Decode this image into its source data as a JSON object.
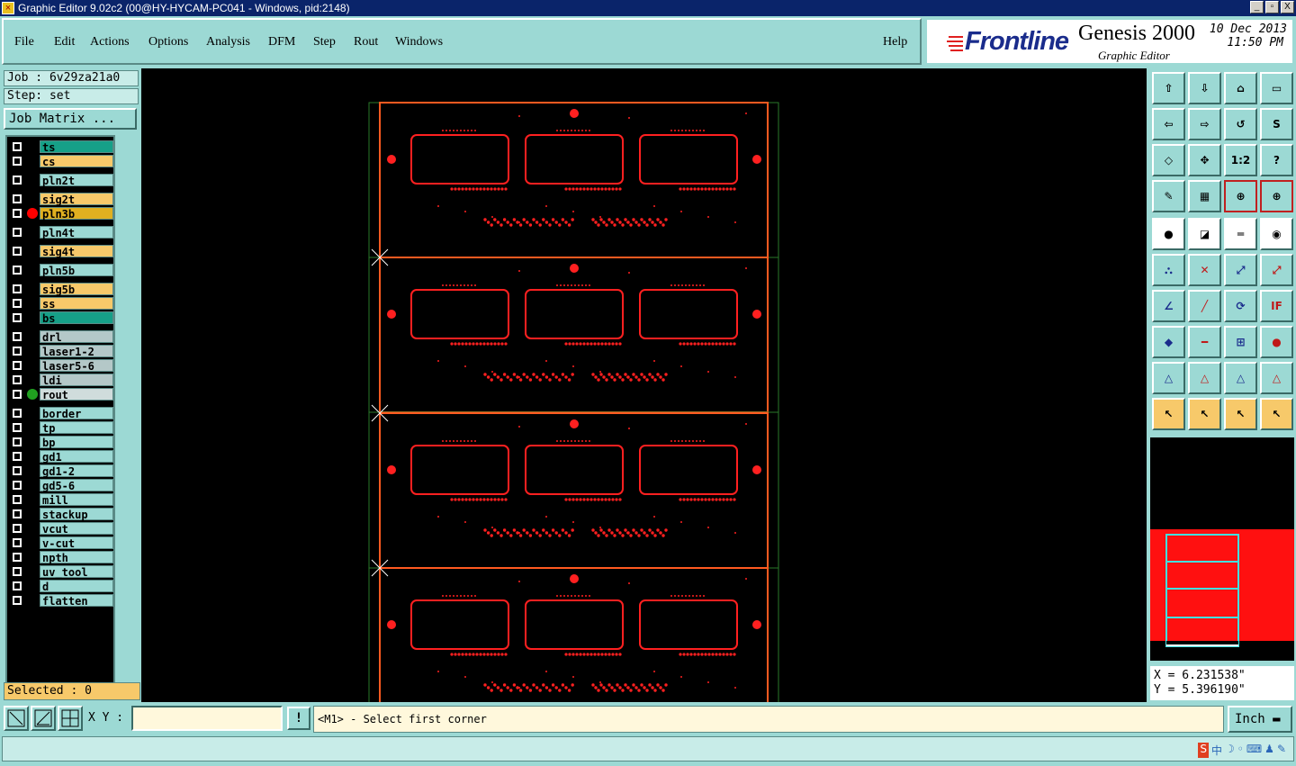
{
  "window": {
    "title": "Graphic Editor 9.02c2 (00@HY-HYCAM-PC041 - Windows, pid:2148)",
    "minimize": "_",
    "maximize": "▫",
    "close": "X"
  },
  "menu": {
    "file": "File",
    "edit": "Edit",
    "actions": "Actions",
    "options": "Options",
    "analysis": "Analysis",
    "dfm": "DFM",
    "step": "Step",
    "rout": "Rout",
    "windows": "Windows",
    "help": "Help"
  },
  "brand": {
    "logo": "Frontline",
    "product": "Genesis 2000",
    "subtitle": "Graphic Editor",
    "date": "10 Dec 2013",
    "time": "11:50 PM"
  },
  "left": {
    "job": "Job : 6v29za21a0",
    "step": "Step: set",
    "job_matrix": "Job Matrix ...",
    "selected": "Selected : 0"
  },
  "layers": [
    {
      "name": "ts",
      "color": "#16a088",
      "dot": ""
    },
    {
      "name": "cs",
      "color": "#f7c96a",
      "dot": ""
    },
    {
      "name": "pln2t",
      "color": "#9cd9d4",
      "dot": ""
    },
    {
      "name": "sig2t",
      "color": "#f7c96a",
      "dot": ""
    },
    {
      "name": "pln3b",
      "color": "#e0b020",
      "dot": "#ff0000"
    },
    {
      "name": "pln4t",
      "color": "#9cd9d4",
      "dot": ""
    },
    {
      "name": "sig4t",
      "color": "#f7c96a",
      "dot": ""
    },
    {
      "name": "pln5b",
      "color": "#9cd9d4",
      "dot": ""
    },
    {
      "name": "sig5b",
      "color": "#f7c96a",
      "dot": ""
    },
    {
      "name": "ss",
      "color": "#f7c96a",
      "dot": ""
    },
    {
      "name": "bs",
      "color": "#16a088",
      "dot": ""
    },
    {
      "name": "drl",
      "color": "#b4c8c8",
      "dot": ""
    },
    {
      "name": "laser1-2",
      "color": "#b4c8c8",
      "dot": ""
    },
    {
      "name": "laser5-6",
      "color": "#b4c8c8",
      "dot": ""
    },
    {
      "name": "ldi",
      "color": "#b4c8c8",
      "dot": ""
    },
    {
      "name": "rout",
      "color": "#d0dcdc",
      "dot": "#20a020"
    },
    {
      "name": "border",
      "color": "#9cd9d4",
      "dot": ""
    },
    {
      "name": "tp",
      "color": "#9cd9d4",
      "dot": ""
    },
    {
      "name": "bp",
      "color": "#9cd9d4",
      "dot": ""
    },
    {
      "name": "gd1",
      "color": "#9cd9d4",
      "dot": ""
    },
    {
      "name": "gd1-2",
      "color": "#9cd9d4",
      "dot": ""
    },
    {
      "name": "gd5-6",
      "color": "#9cd9d4",
      "dot": ""
    },
    {
      "name": "mill",
      "color": "#9cd9d4",
      "dot": ""
    },
    {
      "name": "stackup",
      "color": "#9cd9d4",
      "dot": ""
    },
    {
      "name": "vcut",
      "color": "#9cd9d4",
      "dot": ""
    },
    {
      "name": "v-cut",
      "color": "#9cd9d4",
      "dot": ""
    },
    {
      "name": "npth",
      "color": "#9cd9d4",
      "dot": ""
    },
    {
      "name": "uv_tool",
      "color": "#9cd9d4",
      "dot": ""
    },
    {
      "name": "d",
      "color": "#9cd9d4",
      "dot": ""
    },
    {
      "name": "flatten",
      "color": "#9cd9d4",
      "dot": ""
    }
  ],
  "toolbar_icons": [
    "import-icon",
    "export-icon",
    "home-icon",
    "window-icon",
    "pan-left-icon",
    "pan-right-icon",
    "undo-zoom-icon",
    "redraw-icon",
    "zoom-fit-icon",
    "zoom-center-icon",
    "one-to-one-icon",
    "help-icon",
    "measure-tool-icon",
    "grid-icon",
    "snap-feature-icon",
    "snap-layer-icon",
    "highlight-icon",
    "transform-icon",
    "ruler-icon",
    "pad-icon",
    "connect-icon",
    "delete-icon",
    "add-point-icon",
    "move-point-icon",
    "angle-line-icon",
    "line-icon",
    "arc-icon",
    "text-icon",
    "pad-add-icon",
    "trim-icon",
    "resize-icon",
    "shape-icon",
    "triangle-icon",
    "triangle-outline-icon",
    "triangle-frame-icon",
    "triangle-cut-icon",
    "select-icon",
    "select-box-icon",
    "select-polygon-icon",
    "select-net-icon"
  ],
  "toolbar_glyphs": [
    "⇧",
    "⇩",
    "⌂",
    "▭",
    "⇦",
    "⇨",
    "↺",
    "S",
    "◇",
    "✥",
    "1:2",
    "?",
    "✎",
    "▦",
    "⊕",
    "⊕",
    "●",
    "◪",
    "═",
    "◉",
    "⛬",
    "✕",
    "⤢",
    "⤢",
    "∠",
    "╱",
    "⟳",
    "IF",
    "◆",
    "━",
    "⊞",
    "●",
    "△",
    "△",
    "△",
    "△",
    "↖",
    "↖",
    "↖",
    "↖"
  ],
  "coords": {
    "x": "X = 6.231538\"",
    "y": "Y = 5.396190\""
  },
  "status": {
    "xy_label": "X Y :",
    "xy_value": "",
    "excl": "!",
    "prompt": "<M1> - Select first corner",
    "unit": "Inch"
  },
  "tray": [
    "S",
    "中",
    "☽",
    "◦",
    "⌨",
    "♟",
    "✎"
  ],
  "colors": {
    "accent": "#9cd9d4",
    "feature": "#ff2020",
    "profile": "#ff5a20",
    "grid": "#2a7a2a"
  }
}
